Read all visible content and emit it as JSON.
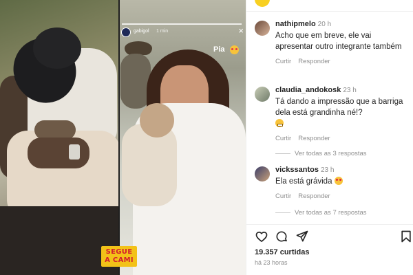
{
  "media": {
    "brand_line1": "SEGUE",
    "brand_line2": "A CAMI",
    "story": {
      "username": "gabigol",
      "time": "1 min",
      "caption": "Pia"
    }
  },
  "comments": [
    {
      "username": "nathipmelo",
      "time": "20 h",
      "text": "Acho que em breve, ele vai apresentar outro integrante também",
      "reply_label": "Curtir",
      "answer_label": "Responder"
    },
    {
      "username": "claudia_andokosk",
      "time": "23 h",
      "text": "Tá dando a impressão que a barriga dela está grandinha né!?",
      "reply_label": "Curtir",
      "answer_label": "Responder",
      "replies_label": "Ver todas as 3 respostas"
    },
    {
      "username": "vickssantos",
      "time": "23 h",
      "text": "Ela está grávida",
      "reply_label": "Curtir",
      "answer_label": "Responder",
      "replies_label": "Ver todas as 7 respostas"
    }
  ],
  "footer": {
    "likes": "19.357 curtidas",
    "posted": "há 23 horas"
  },
  "colors": {
    "brand_yellow": "#f3c218",
    "brand_red": "#d41f2c",
    "muted_text": "#8e8e8e"
  },
  "icons": [
    "heart-icon",
    "comment-icon",
    "share-icon",
    "bookmark-icon",
    "close-icon"
  ]
}
